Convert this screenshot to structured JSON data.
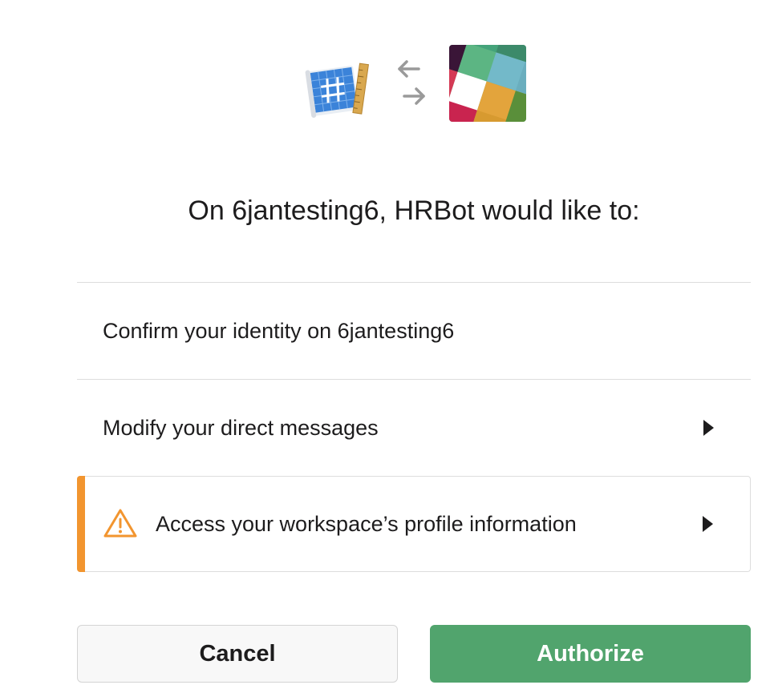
{
  "header": {
    "app_icon": "blueprint-app-icon",
    "swap_icon": "swap-arrows-icon",
    "service_icon": "slack-logo-icon",
    "title": "On 6jantesting6, HRBot would like to:"
  },
  "permissions": [
    {
      "label": "Confirm your identity on 6jantesting6",
      "expandable": false,
      "warning": false
    },
    {
      "label": "Modify your direct messages",
      "expandable": true,
      "warning": false
    },
    {
      "label": "Access your workspace’s profile information",
      "expandable": true,
      "warning": true
    }
  ],
  "actions": {
    "cancel_label": "Cancel",
    "authorize_label": "Authorize"
  },
  "colors": {
    "authorize_bg": "#51a46d",
    "warning_accent": "#f2952f",
    "text": "#1d1c1d"
  }
}
